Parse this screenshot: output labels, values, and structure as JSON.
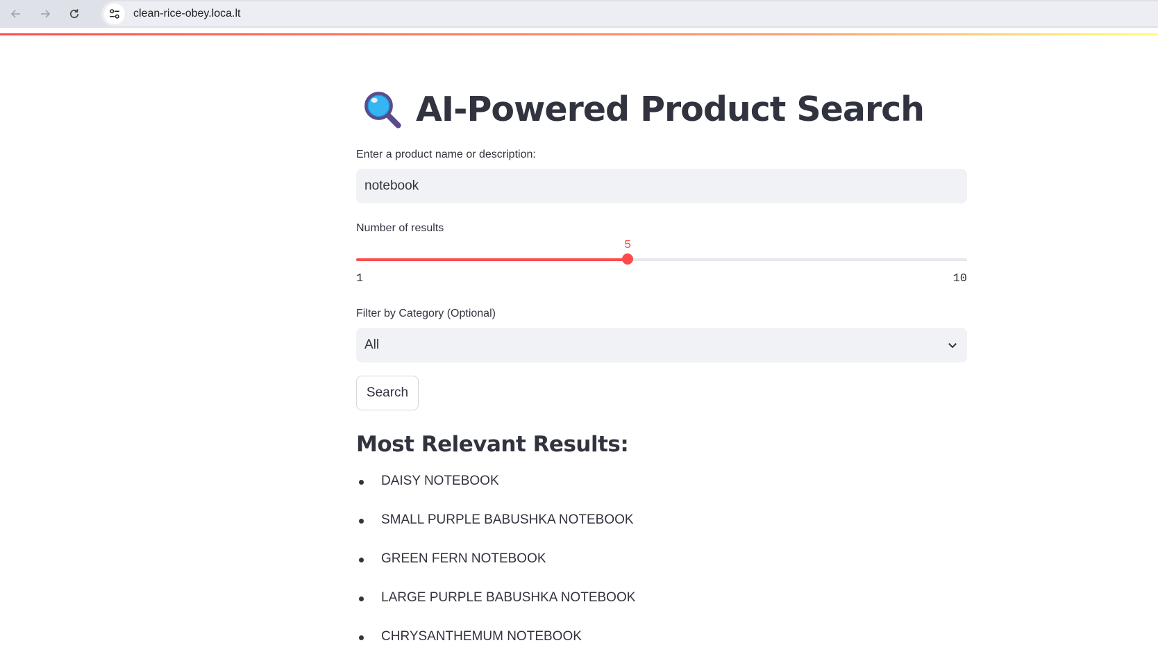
{
  "browser": {
    "url": "clean-rice-obey.loca.lt",
    "back_icon": "arrow-left-icon",
    "forward_icon": "arrow-right-icon",
    "reload_icon": "reload-icon",
    "site_info_icon": "tune-icon"
  },
  "header": {
    "icon": "magnifying-glass-icon",
    "title": "AI-Powered Product Search"
  },
  "search": {
    "label": "Enter a product name or description:",
    "value": "notebook"
  },
  "num_results": {
    "label": "Number of results",
    "min": 1,
    "max": 10,
    "value": 5,
    "min_label": "1",
    "max_label": "10",
    "value_label": "5",
    "accent_color": "#ff4b4b"
  },
  "category": {
    "label": "Filter by Category (Optional)",
    "selected": "All",
    "icon": "chevron-down-icon"
  },
  "search_button": {
    "label": "Search"
  },
  "results": {
    "heading": "Most Relevant Results:",
    "items": [
      "DAISY NOTEBOOK",
      "SMALL PURPLE BABUSHKA NOTEBOOK",
      "GREEN FERN NOTEBOOK",
      "LARGE PURPLE BABUSHKA NOTEBOOK",
      "CHRYSANTHEMUM NOTEBOOK"
    ]
  }
}
